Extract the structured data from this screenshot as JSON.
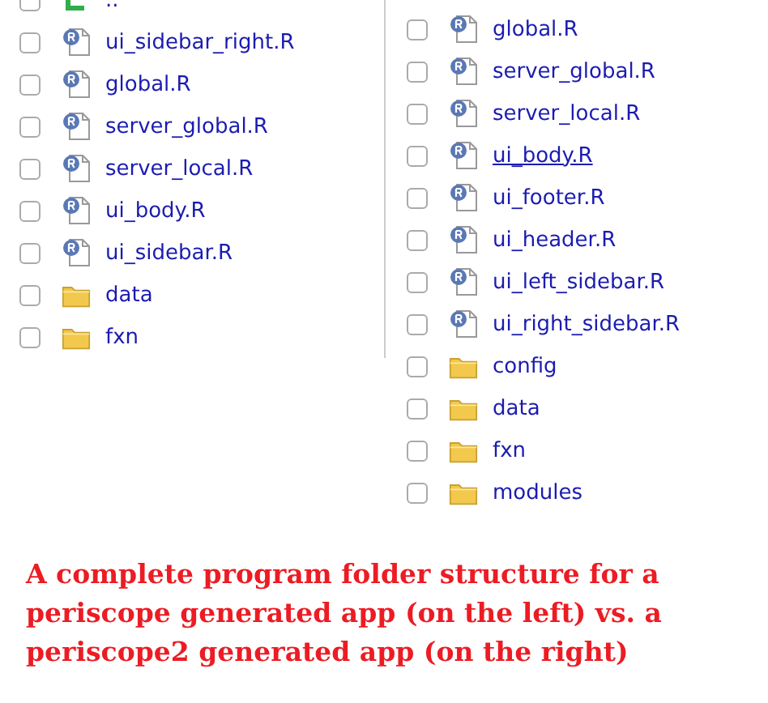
{
  "left_panel": {
    "items": [
      {
        "kind": "parent",
        "name": "..",
        "checked": false,
        "hovered": false
      },
      {
        "kind": "r-file",
        "name": "ui_sidebar_right.R",
        "checked": false,
        "hovered": false
      },
      {
        "kind": "r-file",
        "name": "global.R",
        "checked": false,
        "hovered": false
      },
      {
        "kind": "r-file",
        "name": "server_global.R",
        "checked": false,
        "hovered": false
      },
      {
        "kind": "r-file",
        "name": "server_local.R",
        "checked": false,
        "hovered": false
      },
      {
        "kind": "r-file",
        "name": "ui_body.R",
        "checked": false,
        "hovered": false
      },
      {
        "kind": "r-file",
        "name": "ui_sidebar.R",
        "checked": false,
        "hovered": false
      },
      {
        "kind": "folder",
        "name": "data",
        "checked": false,
        "hovered": false
      },
      {
        "kind": "folder",
        "name": "fxn",
        "checked": false,
        "hovered": false
      }
    ]
  },
  "right_panel": {
    "items": [
      {
        "kind": "r-file",
        "name": "global.R",
        "checked": false,
        "hovered": false
      },
      {
        "kind": "r-file",
        "name": "server_global.R",
        "checked": false,
        "hovered": false
      },
      {
        "kind": "r-file",
        "name": "server_local.R",
        "checked": false,
        "hovered": false
      },
      {
        "kind": "r-file",
        "name": "ui_body.R",
        "checked": false,
        "hovered": true
      },
      {
        "kind": "r-file",
        "name": "ui_footer.R",
        "checked": false,
        "hovered": false
      },
      {
        "kind": "r-file",
        "name": "ui_header.R",
        "checked": false,
        "hovered": false
      },
      {
        "kind": "r-file",
        "name": "ui_left_sidebar.R",
        "checked": false,
        "hovered": false
      },
      {
        "kind": "r-file",
        "name": "ui_right_sidebar.R",
        "checked": false,
        "hovered": false
      },
      {
        "kind": "folder",
        "name": "config",
        "checked": false,
        "hovered": false
      },
      {
        "kind": "folder",
        "name": "data",
        "checked": false,
        "hovered": false
      },
      {
        "kind": "folder",
        "name": "fxn",
        "checked": false,
        "hovered": false
      },
      {
        "kind": "folder",
        "name": "modules",
        "checked": false,
        "hovered": false
      }
    ]
  },
  "caption": "A complete program folder structure for a periscope generated app (on the left) vs. a periscope2 generated app (on the right)"
}
